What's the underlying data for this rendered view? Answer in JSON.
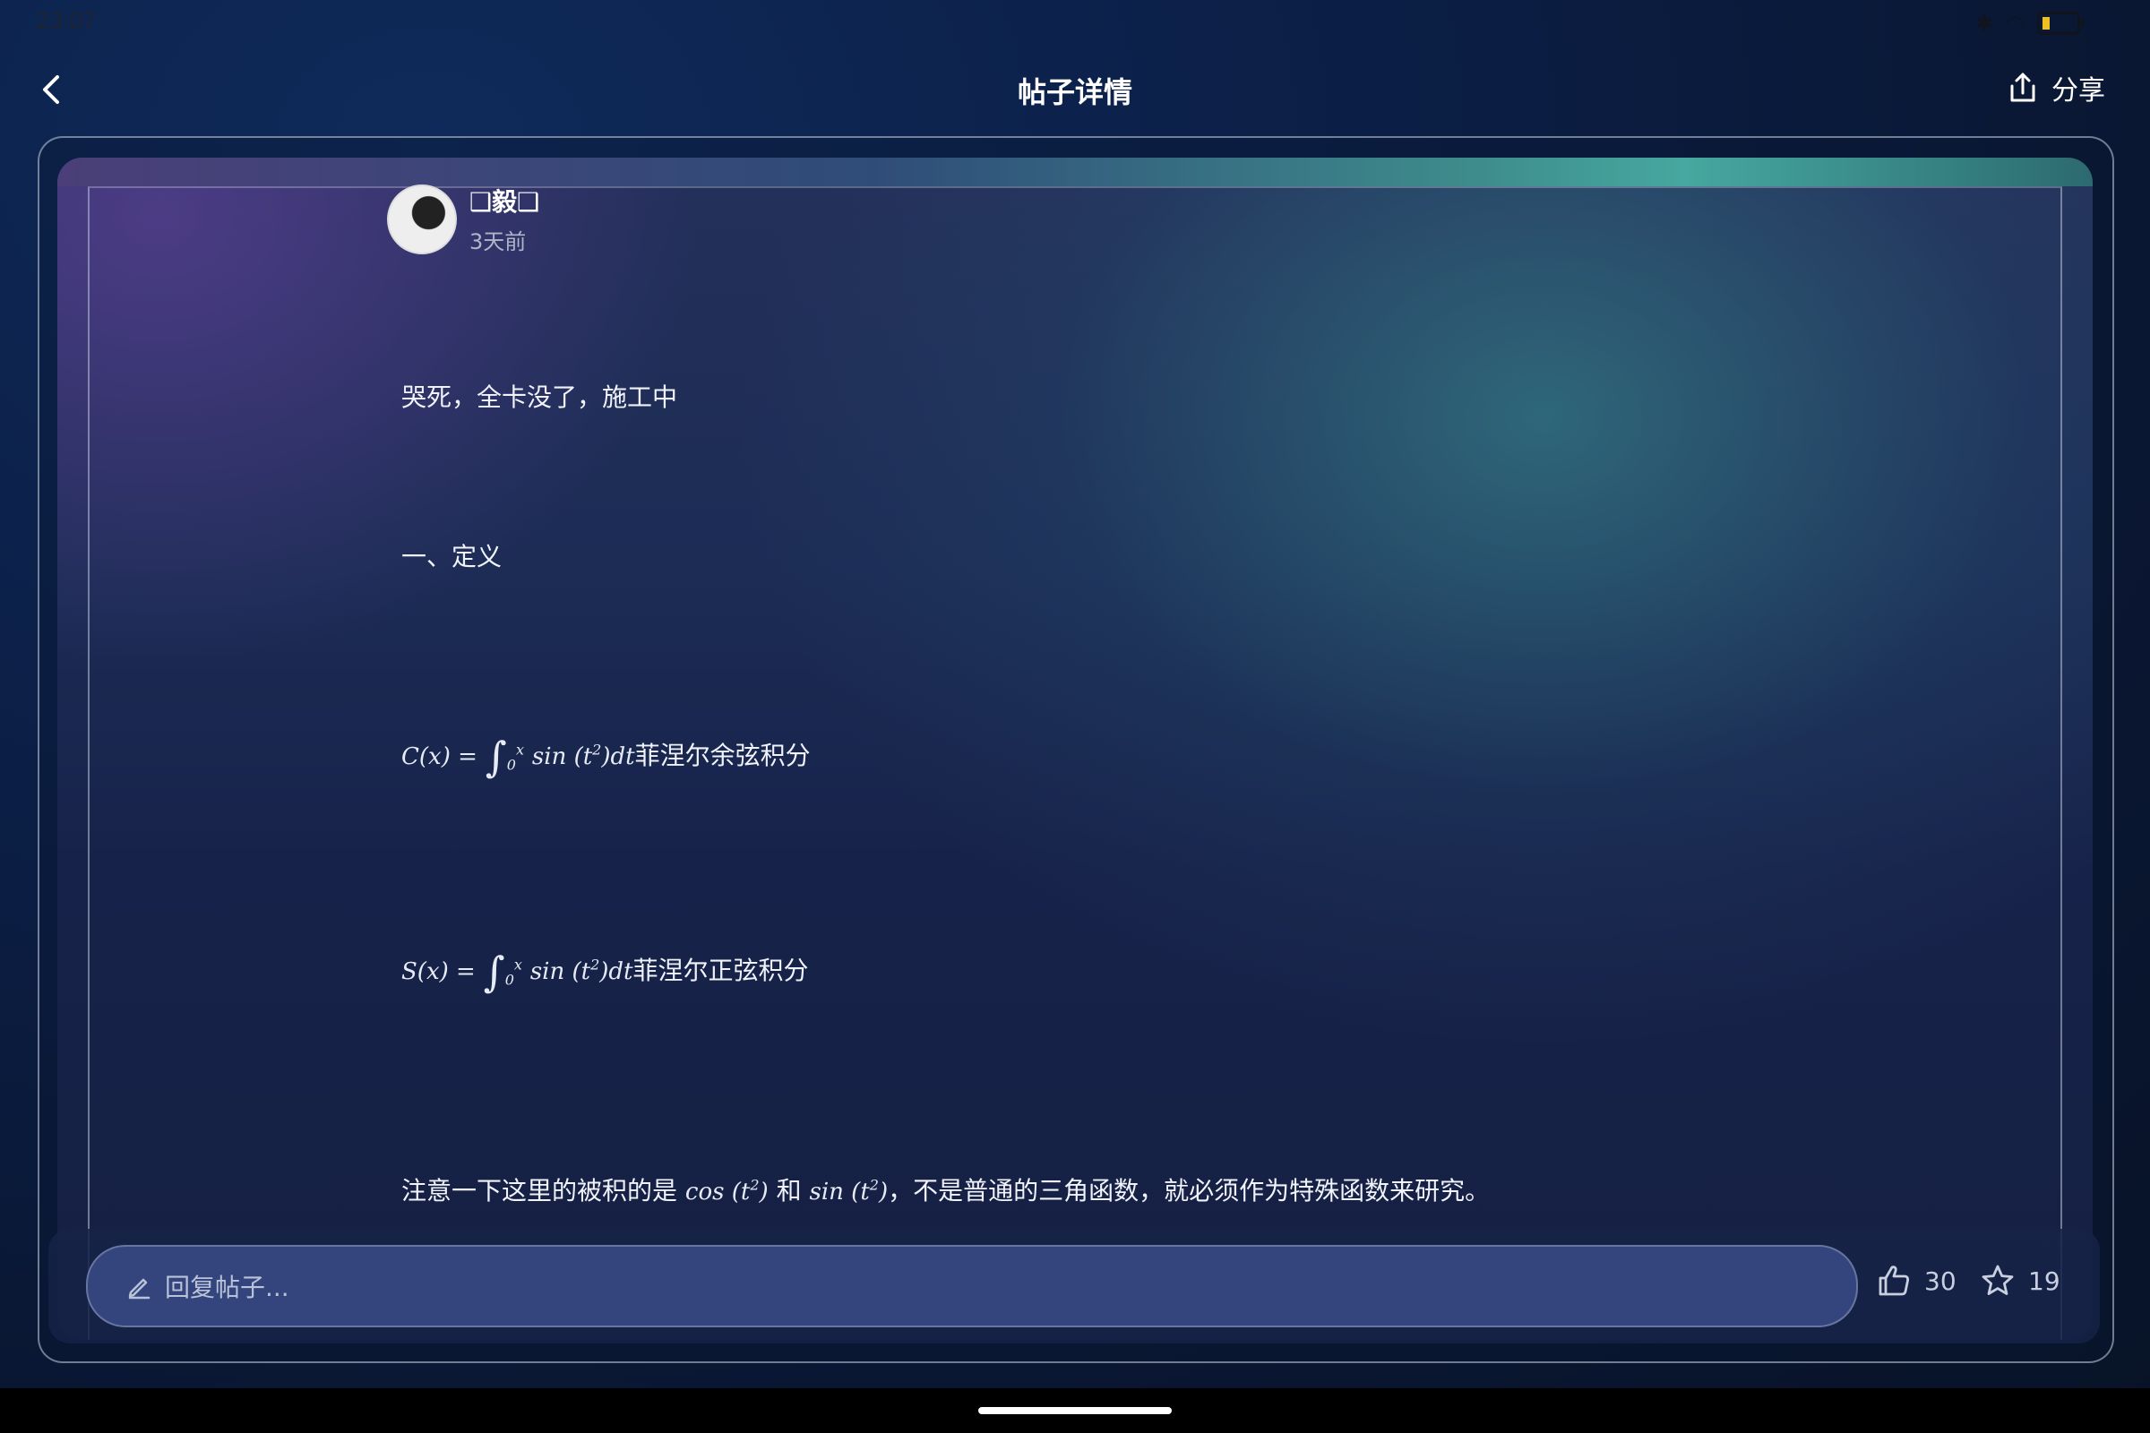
{
  "status_bar": {
    "time": "23:07"
  },
  "header": {
    "title": "帖子详情",
    "share_label": "分享"
  },
  "post": {
    "author_name": "❑毅❑",
    "posted_time": "3天前",
    "paragraphs": {
      "intro": "哭死，全卡没了，施工中",
      "section_heading": "一、定义",
      "c_label": "菲涅尔余弦积分",
      "s_label": "菲涅尔正弦积分",
      "note_prefix": "注意一下这里的被积的是",
      "note_and": "和",
      "note_suffix": "，不是普通的三角函数，就必须作为特殊函数来研究。"
    },
    "formulas": {
      "c_lhs": "C(x) =",
      "s_lhs": "S(x) =",
      "integrand": "sin (t",
      "integrand_close": ")dt",
      "upper": "x",
      "lower": "0",
      "exp": "2",
      "cos_term": "cos (t",
      "sin_term": "sin (t",
      "close_paren": ")"
    }
  },
  "reply_bar": {
    "placeholder": "回复帖子...",
    "likes": "30",
    "favorites": "19"
  },
  "icons": {
    "back": "chevron-left-icon",
    "share": "share-upload-icon",
    "pencil": "pencil-icon",
    "like": "thumbs-up-icon",
    "favorite": "star-icon"
  }
}
